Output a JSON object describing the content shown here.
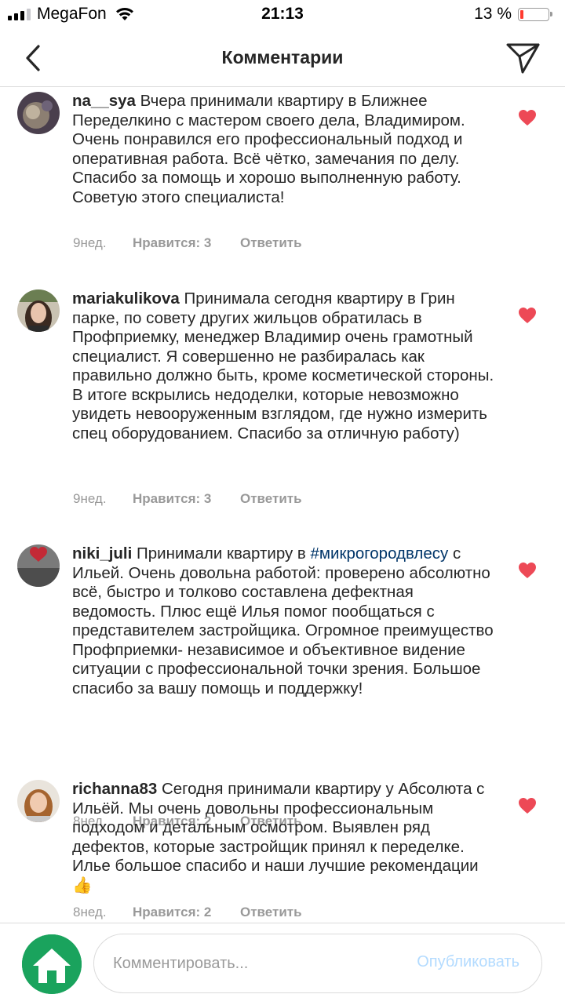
{
  "status_bar": {
    "carrier": "MegaFon",
    "time": "21:13",
    "battery_percent": "13 %",
    "battery_level": 0.13
  },
  "header": {
    "title": "Комментарии",
    "back_icon": "chevron-left-icon",
    "send_icon": "paper-plane-icon"
  },
  "comments": [
    {
      "username": "na__sya",
      "text": "Вчера принимали квартиру в Ближнее Переделкино с мастером своего дела, Владимиром. Очень понравился его профессиональный подход и оперативная работа. Всё чётко, замечания по делу. Спасибо за помощь и хорошо выполненную работу. Советую этого специалиста!",
      "age": "9нед.",
      "likes": "Нравится: 3",
      "reply": "Ответить",
      "liked": true
    },
    {
      "username": "mariakulikova",
      "text": "Принимала сегодня квартиру в Грин парке, по совету других жильцов обратилась в Профприемку, менеджер Владимир очень грамотный специалист. Я совершенно не разбиралась как правильно должно быть, кроме косметической стороны. В итоге вскрылись недоделки, которые невозможно увидеть невооруженным взглядом, где нужно измерить спец оборудованием. Спасибо за отличную работу)",
      "age": "9нед.",
      "likes": "Нравится: 3",
      "reply": "Ответить",
      "liked": true
    },
    {
      "username": "niki_juli",
      "text_before": "Принимали квартиру в ",
      "hashtag": "#микрогородвлесу",
      "text_after": " с Ильей. Очень довольна работой: проверено абсолютно всё, быстро и толково составлена дефектная ведомость. Плюс ещё Илья помог пообщаться с представителем застройщика. Огромное преимущество Профприемки- независимое и объективное видение ситуации с профессиональной точки зрения. Большое спасибо за вашу помощь и поддержку!",
      "age": "8нед.",
      "likes": "Нравится: 2",
      "reply": "Ответить",
      "liked": true
    },
    {
      "username": "richanna83",
      "text": "Сегодня принимали квартиру у Абсолюта с Ильёй. Мы очень довольны профессиональным подходом и детальным осмотром. Выявлен ряд дефектов, которые застройщик принял к переделке. Илье большое спасибо и наши лучшие рекомендации",
      "emoji": "👍",
      "age": "8нед.",
      "likes": "Нравится: 2",
      "reply": "Ответить",
      "liked": true
    }
  ],
  "composer": {
    "placeholder": "Комментировать...",
    "publish_label": "Опубликовать"
  },
  "colors": {
    "heart": "#ed4956",
    "hashtag": "#003569",
    "muted": "#999999",
    "publish_disabled": "#b3dbff",
    "avatar_green": "#1aa35d"
  }
}
